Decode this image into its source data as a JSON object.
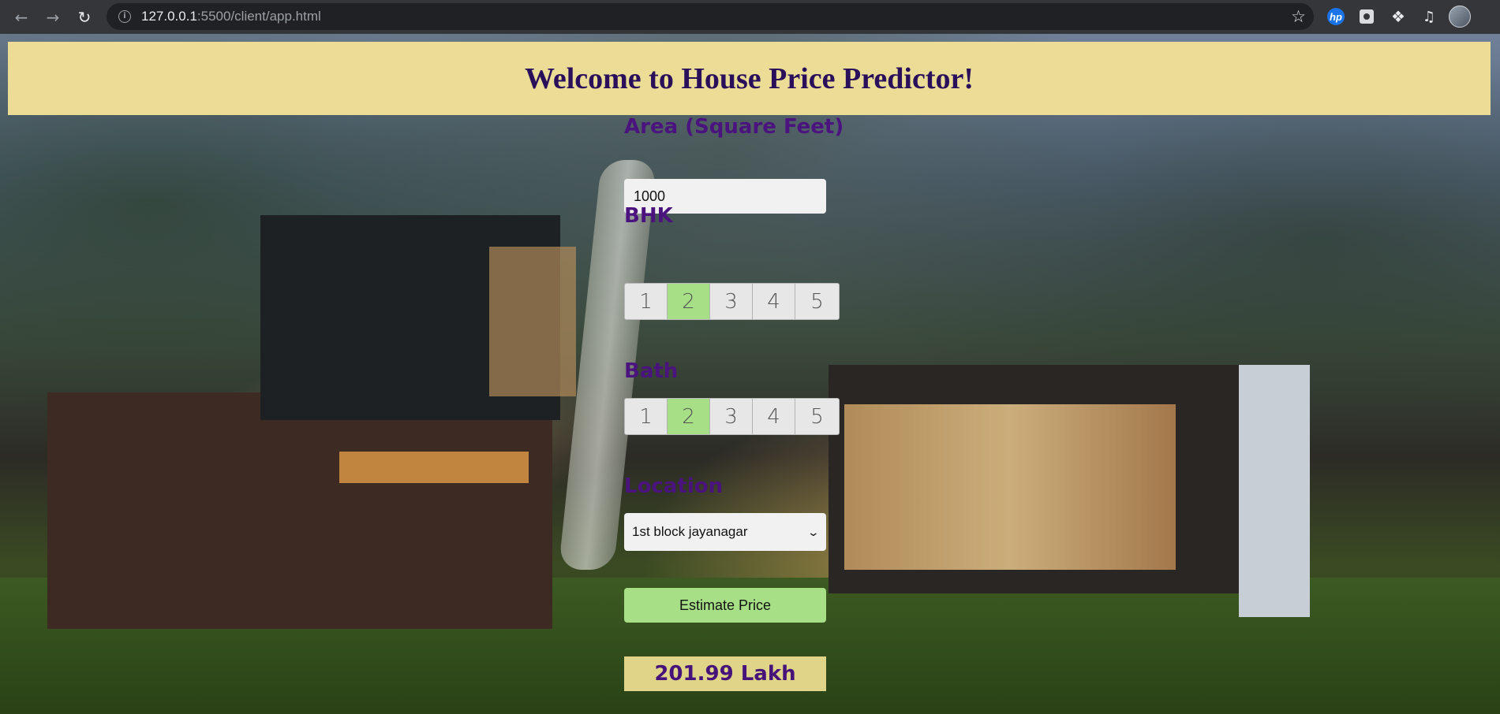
{
  "browser": {
    "url_host": "127.0.0.1",
    "url_path": ":5500/client/app.html",
    "icons": [
      "back-icon",
      "forward-icon",
      "reload-icon",
      "info-icon",
      "star-icon",
      "hp-extension-icon",
      "extension-icon",
      "puzzle-icon",
      "media-icon",
      "profile-avatar"
    ]
  },
  "banner": {
    "title": "Welcome to House Price Predictor!"
  },
  "form": {
    "area_label": "Area (Square Feet)",
    "area_value": "1000",
    "bhk_label": "BHK",
    "bhk_options": [
      "1",
      "2",
      "3",
      "4",
      "5"
    ],
    "bhk_selected": "2",
    "bath_label": "Bath",
    "bath_options": [
      "1",
      "2",
      "3",
      "4",
      "5"
    ],
    "bath_selected": "2",
    "location_label": "Location",
    "location_value": "1st block jayanagar",
    "estimate_button": "Estimate Price",
    "result": "201.99 Lakh"
  },
  "colors": {
    "banner_bg": "#ebdd96",
    "title_text": "#2a105a",
    "label_text": "#4b137e",
    "active_green": "#a7df87",
    "result_bg": "#dfd487"
  }
}
